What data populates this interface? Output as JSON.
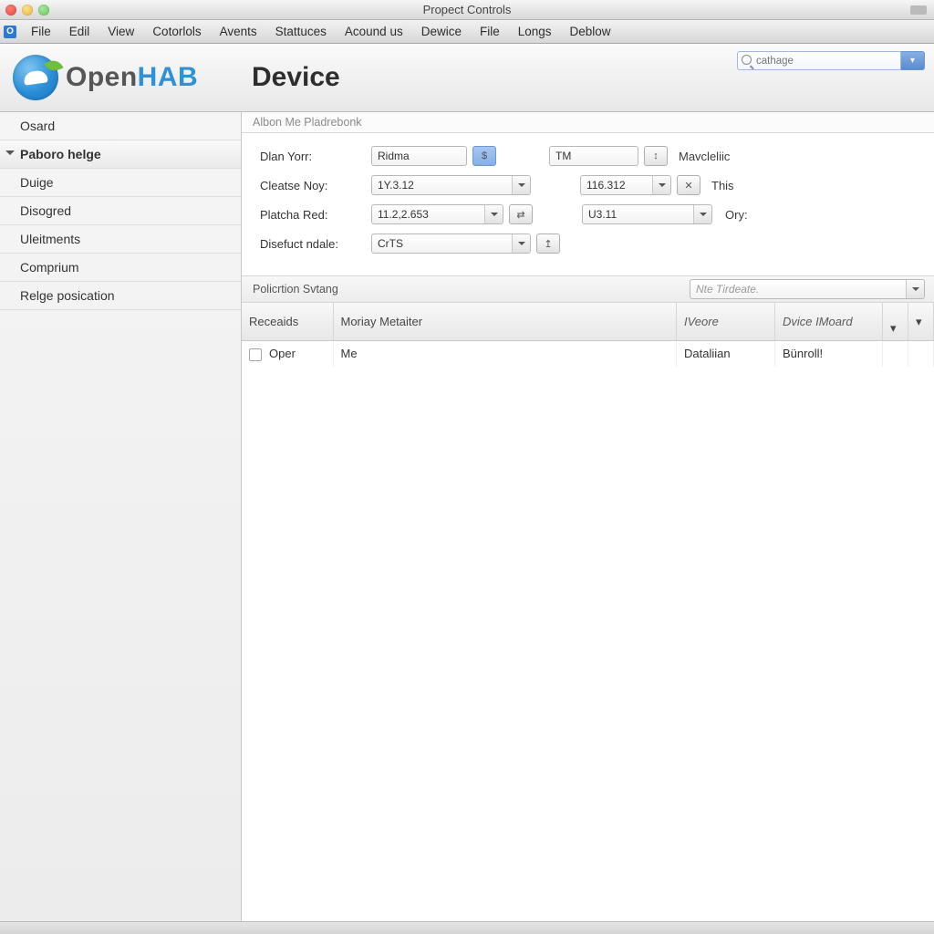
{
  "window": {
    "title": "Propect Controls"
  },
  "menubar": {
    "items": [
      "File",
      "Edil",
      "View",
      "Cotorlols",
      "Avents",
      "Stattuces",
      "Acound us",
      "Dewice",
      "File",
      "Longs",
      "Deblow"
    ]
  },
  "header": {
    "logo_main": "Open",
    "logo_accent": "HAB",
    "page_title": "Device",
    "search_placeholder": "cathage"
  },
  "sidebar": {
    "items": [
      {
        "label": "Osard",
        "sel": false
      },
      {
        "label": "Paboro helge",
        "sel": true
      },
      {
        "label": "Duige",
        "sel": false
      },
      {
        "label": "Disogred",
        "sel": false
      },
      {
        "label": "Uleitments",
        "sel": false
      },
      {
        "label": "Comprium",
        "sel": false
      },
      {
        "label": "Relge posication",
        "sel": false
      }
    ]
  },
  "crumb": "Albon Me Pladrebonk",
  "form": {
    "rows": [
      {
        "label": "Dlan Yorr:",
        "v1": "Ridma",
        "btn1": "$",
        "v2": "TM",
        "btn2": "↕",
        "after": "Mavcleliic"
      },
      {
        "label": "Cleatse Noy:",
        "v1": "1Y.3.12",
        "combo1": true,
        "v2": "116.312",
        "combo2": true,
        "btn2": "✕",
        "after": "This"
      },
      {
        "label": "Platcha Red:",
        "v1": "11.2,2.653",
        "combo1": true,
        "btn1": "⇄",
        "v2": "U3.11",
        "combo2": true,
        "after": "Ory:"
      },
      {
        "label": "Disefuct ndale:",
        "v1": "CrTS",
        "combo1": true,
        "btn1": "↥"
      }
    ]
  },
  "section": {
    "label": "Policrtion Svtang",
    "combo_placeholder": "Nte Tirdeate."
  },
  "table": {
    "headers": [
      "Receaids",
      "Moriay Metaiter",
      "IVeore",
      "Dvice IMoard",
      "",
      ""
    ],
    "row": {
      "c0": "Oper",
      "c1": "Me",
      "c2": "Dataliian",
      "c3": "Bünroll!"
    }
  }
}
